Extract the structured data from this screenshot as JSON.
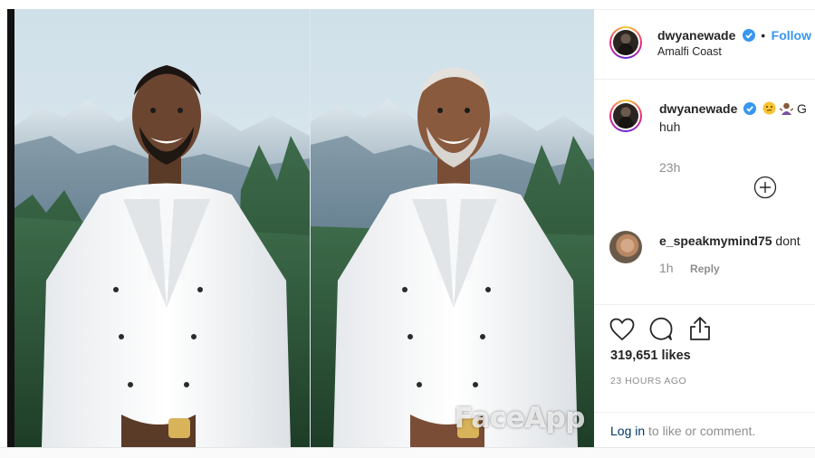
{
  "post": {
    "author": "dwyanewade",
    "follow_separator": "•",
    "follow_label": "Follow",
    "location": "Amalfi Coast",
    "watermark": "FaceApp"
  },
  "caption": {
    "username": "dwyanewade",
    "text_start": "G",
    "text_line2": "huh",
    "time": "23h"
  },
  "comment": {
    "username": "e_speakmymind75",
    "text": "dont",
    "time": "1h",
    "reply_label": "Reply"
  },
  "likes": {
    "count": "319,651 likes",
    "timestamp": "23 HOURS AGO"
  },
  "login": {
    "link": "Log in",
    "rest": "to like or comment."
  },
  "colors": {
    "link_blue": "#3897f0",
    "verified_blue": "#3897f0",
    "text": "#262626",
    "muted": "#8e8e8e"
  },
  "icons": [
    "verified-badge",
    "thinking-face-emoji",
    "shrug-emoji",
    "add-comment-icon",
    "heart-icon",
    "comment-icon",
    "share-icon"
  ]
}
